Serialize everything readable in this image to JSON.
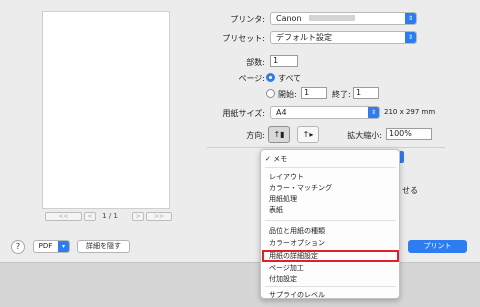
{
  "form": {
    "printer_label": "プリンタ:",
    "printer_value": "Canon",
    "preset_label": "プリセット:",
    "preset_value": "デフォルト設定",
    "copies_label": "部数:",
    "copies_value": "1",
    "pages_label": "ページ:",
    "pages_all": "すべて",
    "pages_from_label": "開始:",
    "pages_from_value": "1",
    "pages_to_label": "終了:",
    "pages_to_value": "1",
    "paper_size_label": "用紙サイズ:",
    "paper_size_value": "A4",
    "paper_size_dims": "210 x 297 mm",
    "orientation_label": "方向:",
    "scale_label": "拡大縮小:",
    "scale_value": "100%",
    "peek_text": "せる"
  },
  "preview": {
    "page_count": "1 / 1",
    "first_label": "<<",
    "prev_label": "<",
    "next_label": ">",
    "last_label": ">>"
  },
  "menu": {
    "items": [
      "✓ メモ",
      "レイアウト",
      "カラー・マッチング",
      "用紙処理",
      "表紙",
      "品位と用紙の種類",
      "カラーオプション",
      "用紙の詳細設定",
      "ページ加工",
      "付加設定",
      "サプライのレベル"
    ],
    "highlighted": "用紙の詳細設定"
  },
  "footer": {
    "help_label": "?",
    "pdf_label": "PDF",
    "hide_details_label": "詳細を隠す",
    "print_label": "プリント"
  },
  "colors": {
    "accent": "#2d7cf0",
    "highlight_border": "#e0202a"
  }
}
